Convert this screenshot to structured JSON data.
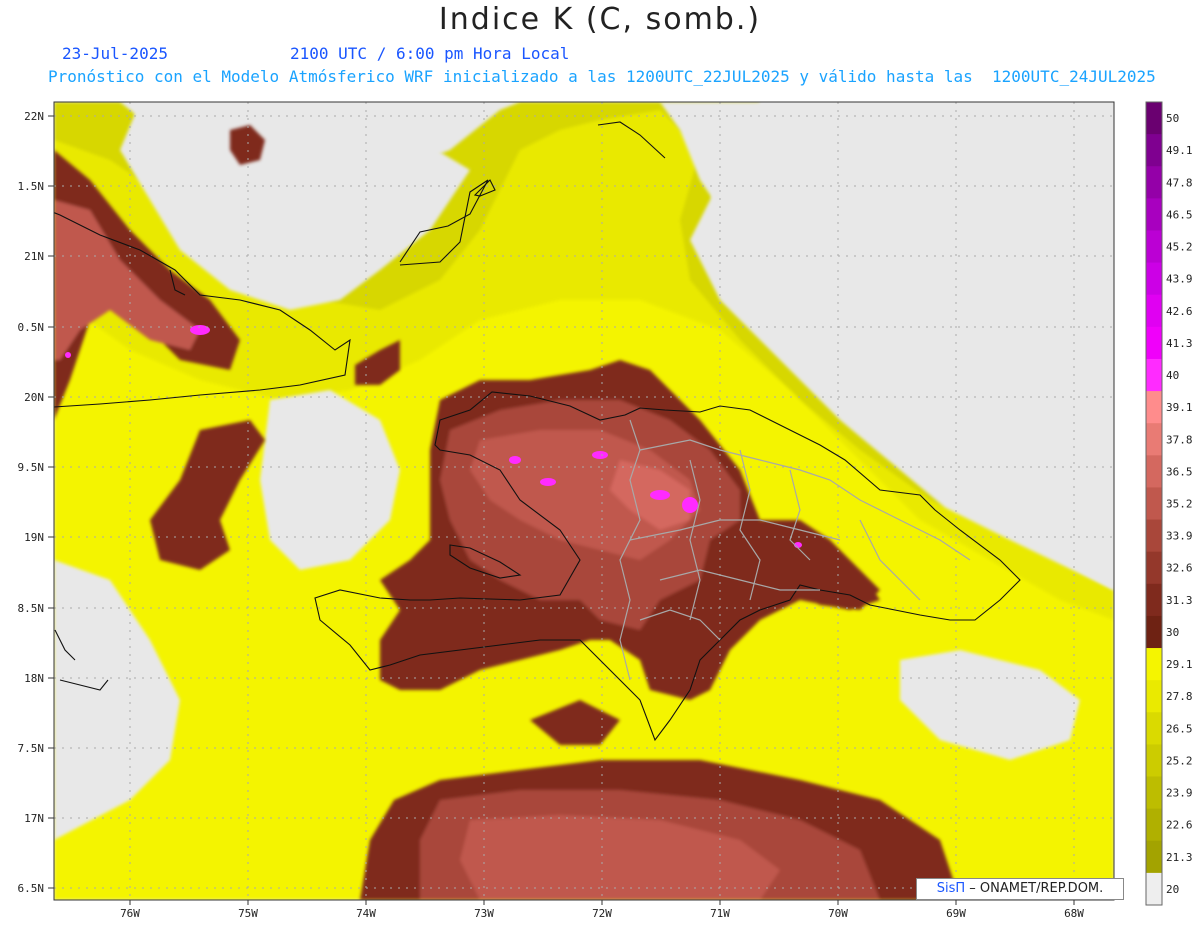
{
  "header": {
    "title": "Indice K (C, somb.)",
    "date": "23-Jul-2025",
    "time": "2100 UTC / 6:00 pm Hora Local",
    "description": "Pronóstico con el Modelo Atmósferico WRF inicializado a las 1200UTC_22JUL2025 y válido hasta las  1200UTC_24JUL2025"
  },
  "map": {
    "lat_labels": [
      "22N",
      "1.5N",
      "21N",
      "0.5N",
      "20N",
      "9.5N",
      "19N",
      "8.5N",
      "18N",
      "7.5N",
      "17N",
      "6.5N"
    ],
    "lon_labels": [
      "76W",
      "75W",
      "74W",
      "73W",
      "72W",
      "71W",
      "70W",
      "69W",
      "68W"
    ]
  },
  "colorbar": {
    "labels": [
      "50",
      "49.1",
      "47.8",
      "46.5",
      "45.2",
      "43.9",
      "42.6",
      "41.3",
      "40",
      "39.1",
      "37.8",
      "36.5",
      "35.2",
      "33.9",
      "32.6",
      "31.3",
      "30",
      "29.1",
      "27.8",
      "26.5",
      "25.2",
      "23.9",
      "22.6",
      "21.3",
      "20"
    ],
    "colors": [
      "#6a0070",
      "#7f0090",
      "#9400a8",
      "#a800bf",
      "#bb00d4",
      "#cc00e6",
      "#e000f2",
      "#f000fa",
      "#ff2bff",
      "#ff8c8c",
      "#e97b74",
      "#d4685f",
      "#c0584d",
      "#a9473a",
      "#94382b",
      "#7f2a1d",
      "#6e2213",
      "#f5f500",
      "#eaea00",
      "#dada00",
      "#cccc00",
      "#bdbd00",
      "#b0b000",
      "#a3a300",
      "#eeeeee"
    ]
  },
  "credit": {
    "brand": "SisΠ",
    "text": " – ONAMET/REP.DOM."
  }
}
